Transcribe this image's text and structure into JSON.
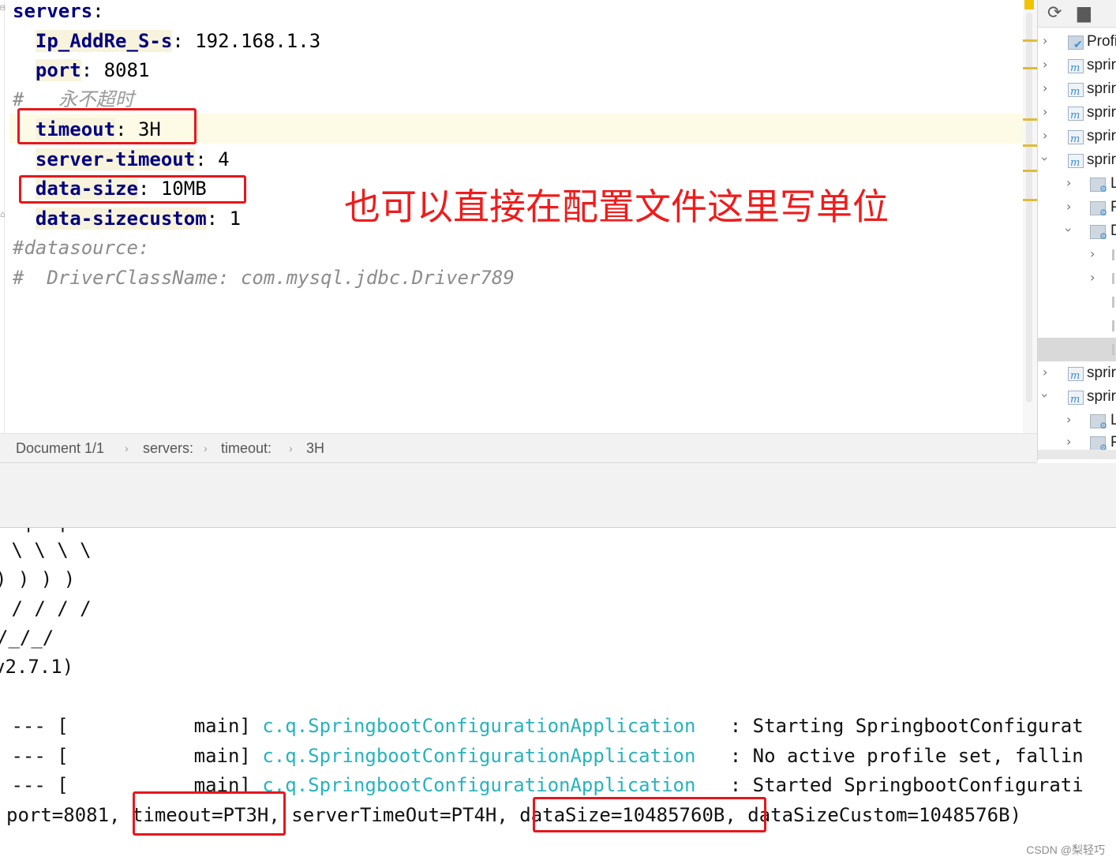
{
  "editor": {
    "lines": {
      "servers_key": "servers",
      "ip_key": "Ip_AddRe_S-s",
      "ip_val": "192.168.1.3",
      "port_key": "port",
      "port_val": "8081",
      "comment_hash": "#",
      "comment_cn": "永不超时",
      "timeout_key": "timeout",
      "timeout_val": "3H",
      "server_timeout_key": "server-timeout",
      "server_timeout_val": "4",
      "data_size_key": "data-size",
      "data_size_val": "10MB",
      "data_sizecustom_key": "data-sizecustom",
      "data_sizecustom_val": "1",
      "datasource_comment": "#datasource:",
      "driver_comment": "#  DriverClassName: com.mysql.jdbc.Driver789"
    },
    "annotation": "也可以直接在配置文件这里写单位",
    "annotation_color": "#ef1c1c"
  },
  "breadcrumb": {
    "items": [
      "Document 1/1",
      "servers:",
      "timeout:",
      "3H"
    ],
    "separator": "›"
  },
  "maven_panel": {
    "toolbar_icons": [
      "refresh-icon",
      "reimport-folder-icon"
    ],
    "items": [
      {
        "label": "Profi",
        "icon": "profiles-icon"
      },
      {
        "label": "sprir",
        "icon": "maven-module-icon"
      },
      {
        "label": "sprir",
        "icon": "maven-module-icon"
      },
      {
        "label": "sprir",
        "icon": "maven-module-icon"
      },
      {
        "label": "sprir",
        "icon": "maven-module-icon"
      },
      {
        "label": "sprir",
        "icon": "maven-module-icon"
      },
      {
        "label": "L",
        "icon": "lifecycle-folder-icon"
      },
      {
        "label": "P",
        "icon": "plugins-folder-icon"
      },
      {
        "label": "D",
        "icon": "dependencies-icon"
      },
      {
        "label": "sprir",
        "icon": "maven-module-icon"
      },
      {
        "label": "sprir",
        "icon": "maven-module-icon"
      },
      {
        "label": "L",
        "icon": "lifecycle-folder-icon"
      },
      {
        "label": "P",
        "icon": "plugins-folder-icon"
      }
    ]
  },
  "console": {
    "banner": [
      " \\ \\ \\ \\",
      ") ) ) )",
      " / / / /",
      "/_/_/",
      "v2.7.1)"
    ],
    "logs": [
      {
        "prefix": " --- [           main] ",
        "logger": "c.q.SpringbootConfigurationApplication",
        "message": "   : Starting SpringbootConfigurat"
      },
      {
        "prefix": " --- [           main] ",
        "logger": "c.q.SpringbootConfigurationApplication",
        "message": "   : No active profile set, fallin"
      },
      {
        "prefix": " --- [           main] ",
        "logger": "c.q.SpringbootConfigurationApplication",
        "message": "   : Started SpringbootConfigurati"
      }
    ],
    "result": {
      "port": "port=8081,",
      "timeout": "timeout=PT3H",
      "comma1": ",",
      "server_timeout": "serverTimeOut=PT4H,",
      "data_size": "dataSize=10485760B",
      "comma2": ",",
      "data_size_custom": "dataSizeCustom=1048576B)"
    },
    "logger_color": "#26b3bd"
  },
  "watermark": "CSDN @梨轻巧"
}
